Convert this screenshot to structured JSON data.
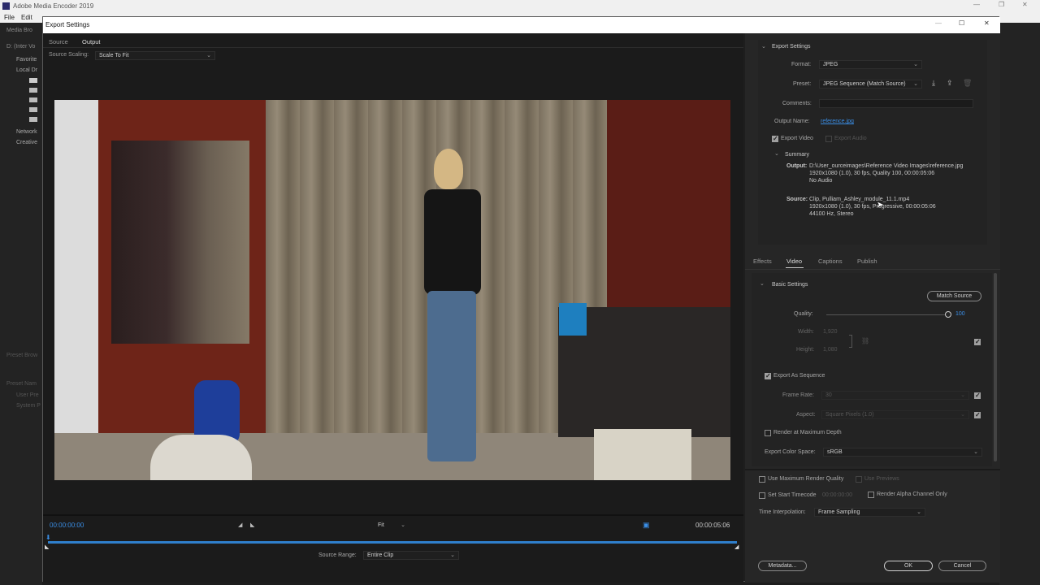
{
  "app": {
    "title": "Adobe Media Encoder 2019",
    "menu": [
      "File",
      "Edit"
    ],
    "bg_left_labels": [
      "Media Bro",
      "D: (Inter Vo",
      "Favorite",
      "Local Dr",
      "Network",
      "Creative",
      "Preset Brow",
      "Preset Nam",
      "User Pre",
      "System P"
    ]
  },
  "dialog": {
    "title": "Export Settings",
    "tabs": [
      "Source",
      "Output"
    ],
    "active_tab": "Output",
    "source_scaling_label": "Source Scaling:",
    "source_scaling_value": "Scale To Fit",
    "timecode_start": "00:00:00:00",
    "timecode_end": "00:00:05:06",
    "fit_value": "Fit",
    "source_range_label": "Source Range:",
    "source_range_value": "Entire Clip"
  },
  "export_settings": {
    "header": "Export Settings",
    "format_label": "Format:",
    "format_value": "JPEG",
    "preset_label": "Preset:",
    "preset_value": "JPEG Sequence (Match Source)",
    "comments_label": "Comments:",
    "output_name_label": "Output Name:",
    "output_name_value": "reference.jpg",
    "export_video_label": "Export Video",
    "export_audio_label": "Export Audio",
    "summary_header": "Summary",
    "output_label": "Output:",
    "output_lines": [
      "D:\\User_ourceimages\\Reference Video Images\\reference.jpg",
      "1920x1080 (1.0), 30 fps, Quality 100, 00:00:05:06",
      "No Audio"
    ],
    "source_label": "Source:",
    "source_lines": [
      "Clip, Pulliam_Ashley_module_11.1.mp4",
      "1920x1080 (1.0), 30 fps, Progressive, 00:00:05:06",
      "44100 Hz, Stereo"
    ]
  },
  "sub_tabs": [
    "Effects",
    "Video",
    "Captions",
    "Publish"
  ],
  "active_sub_tab": "Video",
  "basic_settings": {
    "header": "Basic Settings",
    "match_source_label": "Match Source",
    "quality_label": "Quality:",
    "quality_value": "100",
    "width_label": "Width:",
    "width_value": "1,920",
    "height_label": "Height:",
    "height_value": "1,080",
    "export_as_sequence_label": "Export As Sequence",
    "frame_rate_label": "Frame Rate:",
    "frame_rate_value": "30",
    "aspect_label": "Aspect:",
    "aspect_value": "Square Pixels (1.0)",
    "render_max_depth_label": "Render at Maximum Depth",
    "export_color_space_label": "Export Color Space:",
    "export_color_space_value": "sRGB"
  },
  "bottom_options": {
    "use_max_render_quality": "Use Maximum Render Quality",
    "use_previews": "Use Previews",
    "set_start_timecode": "Set Start Timecode",
    "start_timecode_value": "00:00:00:00",
    "render_alpha": "Render Alpha Channel Only",
    "time_interpolation_label": "Time Interpolation:",
    "time_interpolation_value": "Frame Sampling"
  },
  "buttons": {
    "metadata": "Metadata...",
    "ok": "OK",
    "cancel": "Cancel"
  }
}
